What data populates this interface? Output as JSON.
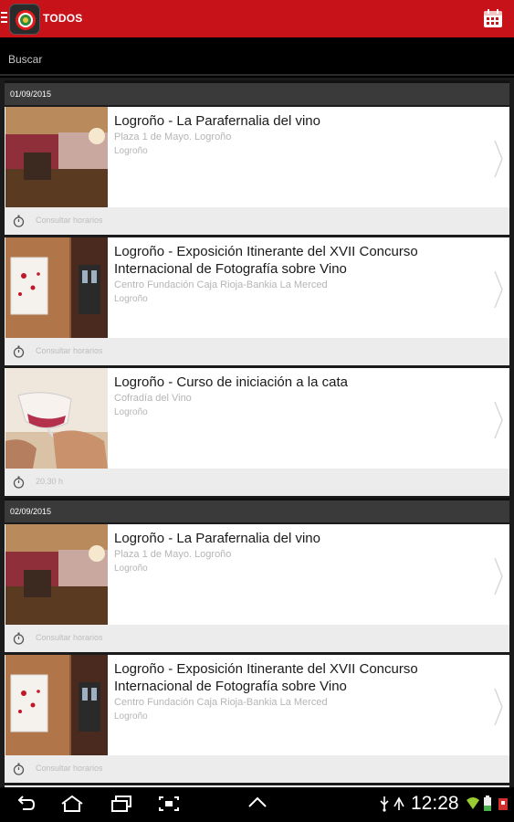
{
  "app": {
    "title": "TODOS",
    "logo_icon": "roundel-logo-icon",
    "calendar_icon": "calendar-icon"
  },
  "search": {
    "placeholder": "Buscar"
  },
  "groups": [
    {
      "date": "01/09/2015",
      "events": [
        {
          "title": "Logroño - La Parafernalia del vino",
          "place": "Plaza 1 de Mayo. Logroño",
          "city": "Logroño",
          "schedule": "Consultar horarios",
          "image": "gallery-photo"
        },
        {
          "title": "Logroño - Exposición Itinerante del XVII Concurso Internacional de Fotografía sobre Vino",
          "place": "Centro Fundación Caja Rioja-Bankia La Merced",
          "city": "Logroño",
          "schedule": "Consultar horarios",
          "image": "exhibition-photo"
        },
        {
          "title": "Logroño - Curso de iniciación a la cata",
          "place": "Cofradía del Vino",
          "city": "Logroño",
          "schedule": "20.30 h",
          "image": "wine-glass-photo"
        }
      ]
    },
    {
      "date": "02/09/2015",
      "events": [
        {
          "title": "Logroño - La Parafernalia del vino",
          "place": "Plaza 1 de Mayo. Logroño",
          "city": "Logroño",
          "schedule": "Consultar horarios",
          "image": "gallery-photo"
        },
        {
          "title": "Logroño - Exposición Itinerante del XVII Concurso Internacional de Fotografía sobre Vino",
          "place": "Centro Fundación Caja Rioja-Bankia La Merced",
          "city": "Logroño",
          "schedule": "Consultar horarios",
          "image": "exhibition-photo"
        }
      ]
    }
  ],
  "system": {
    "time": "12:28"
  },
  "colors": {
    "accent": "#c8121a",
    "header_bg": "#3a3a3a",
    "footer_bg": "#ececec"
  }
}
